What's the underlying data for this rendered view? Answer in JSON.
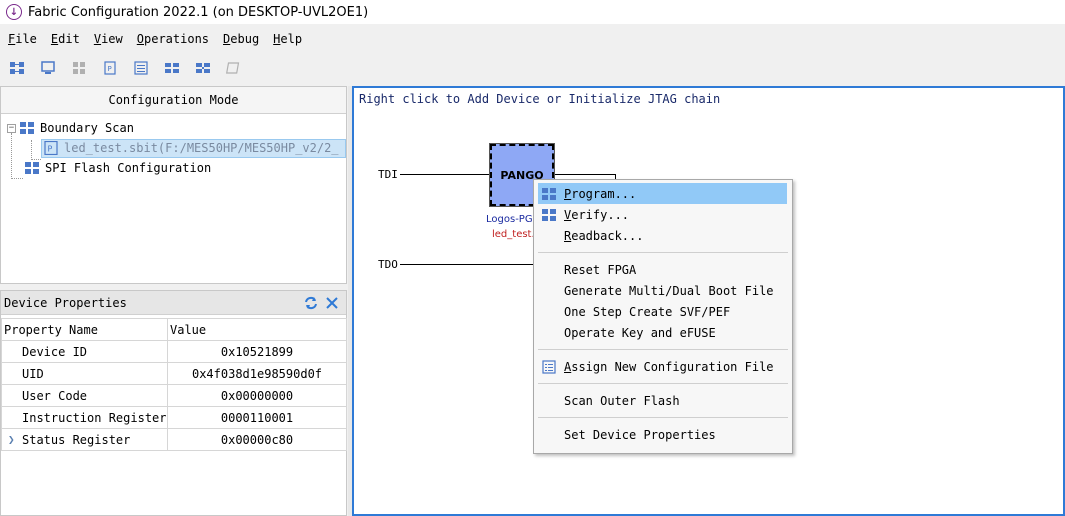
{
  "window": {
    "title": "Fabric Configuration 2022.1 (on DESKTOP-UVL2OE1)"
  },
  "menu": [
    "File",
    "Edit",
    "View",
    "Operations",
    "Debug",
    "Help"
  ],
  "toolbar_icons": [
    "scan-chain-icon",
    "device-icon",
    "grid-icon",
    "program-chip-icon",
    "list-icon",
    "chain-left-icon",
    "chain-right-icon",
    "note-icon"
  ],
  "config_panel": {
    "header": "Configuration Mode",
    "tree": {
      "boundary_scan": "Boundary Scan",
      "bitfile": "led_test.sbit(F:/MES50HP/MES50HP_v2/2_",
      "spi_flash": "SPI Flash Configuration"
    }
  },
  "device_properties": {
    "header": "Device Properties",
    "columns": [
      "Property Name",
      "Value"
    ],
    "rows": [
      {
        "name": "Device ID",
        "value": "0x10521899"
      },
      {
        "name": "UID",
        "value": "0x4f038d1e98590d0f"
      },
      {
        "name": "User Code",
        "value": "0x00000000"
      },
      {
        "name": "Instruction Register",
        "value": "0000110001"
      },
      {
        "name": "Status Register",
        "value": "0x00000c80"
      }
    ]
  },
  "canvas": {
    "hint": "Right click to Add Device or Initialize JTAG chain",
    "tdi": "TDI",
    "tdo": "TDO",
    "chip_label": "PANGO",
    "device_name": "Logos-PG",
    "device_file": "led_test.s"
  },
  "context_menu": {
    "program": "Program...",
    "verify": "Verify...",
    "readback": "Readback...",
    "reset": "Reset FPGA",
    "multiboot": "Generate Multi/Dual Boot File",
    "svf": "One Step Create SVF/PEF",
    "efuse": "Operate Key and eFUSE",
    "assign": "Assign New Configuration File",
    "scan_flash": "Scan Outer Flash",
    "set_props": "Set Device Properties"
  },
  "colors": {
    "accent": "#2f7ad6",
    "highlight": "#91c9f7",
    "chip": "#8ea8f5",
    "selection": "#cce4f7"
  }
}
